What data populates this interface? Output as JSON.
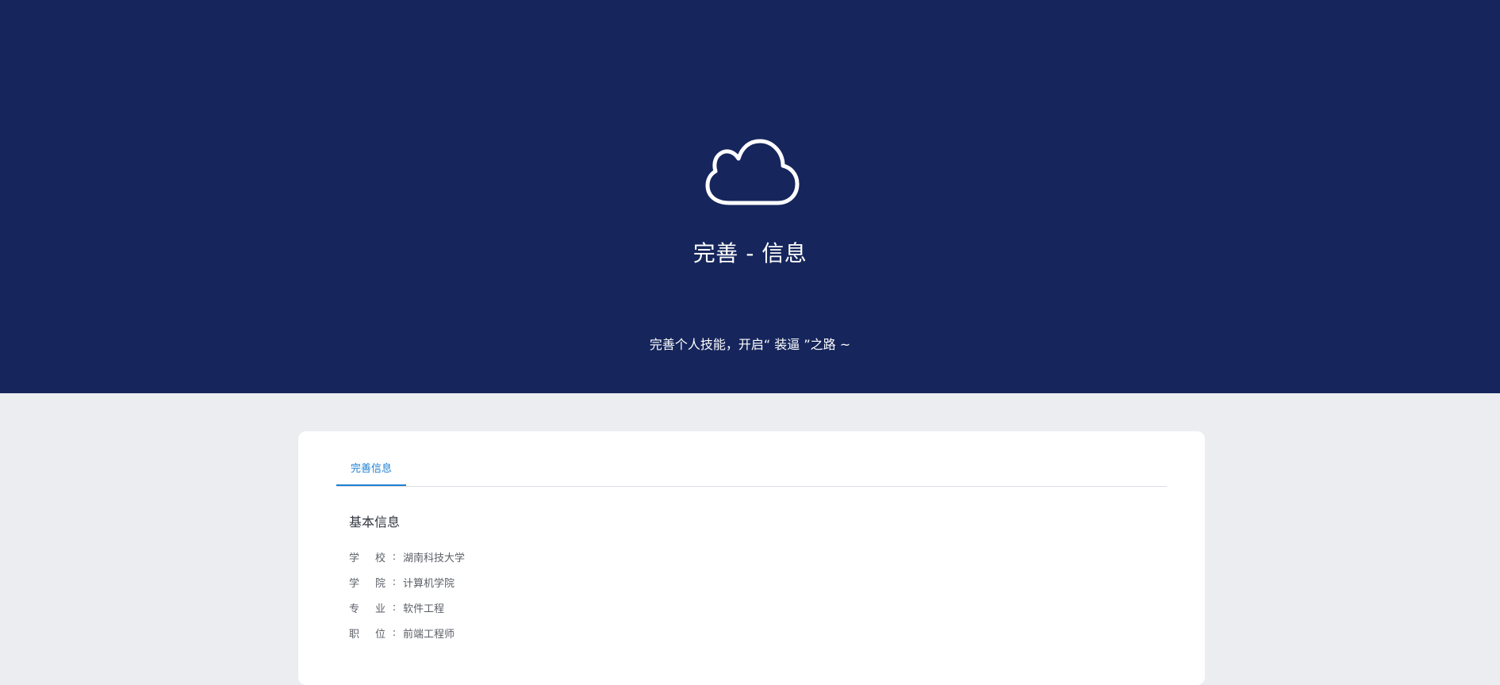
{
  "hero": {
    "icon": "cloud-icon",
    "title": "完善 - 信息",
    "subtitle": "完善个人技能，开启“ 装逼 ”之路 ~",
    "background_color": "#16265c"
  },
  "card": {
    "tabs": [
      {
        "label": "完善信息",
        "active": true
      }
    ],
    "section_title": "基本信息",
    "fields": [
      {
        "label_chars": [
          "学",
          "校"
        ],
        "colon": ":",
        "value": "湖南科技大学"
      },
      {
        "label_chars": [
          "学",
          "院"
        ],
        "colon": ":",
        "value": "计算机学院"
      },
      {
        "label_chars": [
          "专",
          "业"
        ],
        "colon": ":",
        "value": "软件工程"
      },
      {
        "label_chars": [
          "职",
          "位"
        ],
        "colon": ":",
        "value": "前端工程师"
      }
    ]
  },
  "colors": {
    "accent": "#1f7fd1",
    "page_background": "#ebedf0"
  }
}
